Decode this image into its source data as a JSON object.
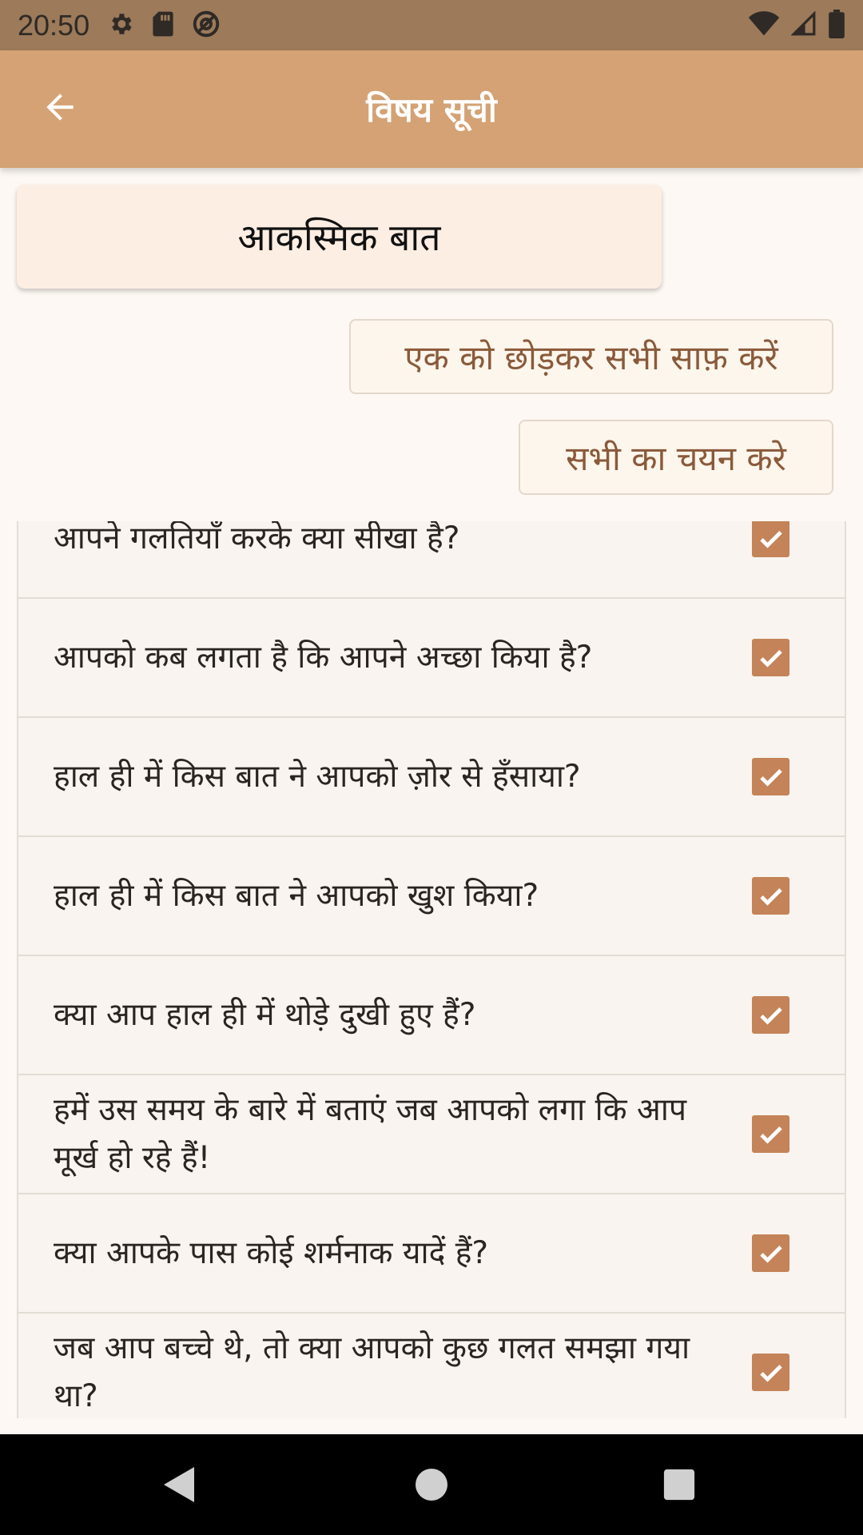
{
  "status_bar": {
    "time": "20:50",
    "icons_left": [
      "gear-icon",
      "sd-card-icon",
      "at-sign-icon"
    ],
    "icons_right": [
      "wifi-icon",
      "signal-icon",
      "battery-icon"
    ]
  },
  "app_bar": {
    "title": "विषय सूची",
    "back_icon": "arrow-left-icon"
  },
  "category": {
    "label": "आकस्मिक बात"
  },
  "actions": {
    "clear_all_but_one": "एक को छोड़कर सभी साफ़ करें",
    "select_all": "सभी का चयन करे"
  },
  "questions": [
    {
      "text": "आपने गलतियाँ करके क्या सीखा है?",
      "checked": true
    },
    {
      "text": "आपको कब लगता है कि आपने अच्छा किया है?",
      "checked": true
    },
    {
      "text": "हाल ही में किस बात ने आपको ज़ोर से हँसाया?",
      "checked": true
    },
    {
      "text": "हाल ही में किस बात ने आपको खुश किया?",
      "checked": true
    },
    {
      "text": "क्या आप हाल ही में थोड़े दुखी हुए हैं?",
      "checked": true
    },
    {
      "text": "हमें उस समय के बारे में बताएं जब आपको लगा कि आप मूर्ख हो रहे हैं!",
      "checked": true
    },
    {
      "text": "क्या आपके पास कोई शर्मनाक यादें हैं?",
      "checked": true
    },
    {
      "text": "जब आप बच्चे थे, तो क्या आपको कुछ गलत समझा गया था?",
      "checked": true
    }
  ],
  "nav_bar": {
    "buttons": [
      "back-triangle-icon",
      "home-circle-icon",
      "recents-square-icon"
    ]
  },
  "colors": {
    "status_bar": "#9c7a5a",
    "app_bar": "#d4a274",
    "accent": "#c48358",
    "button_text": "#8a5a3b"
  }
}
